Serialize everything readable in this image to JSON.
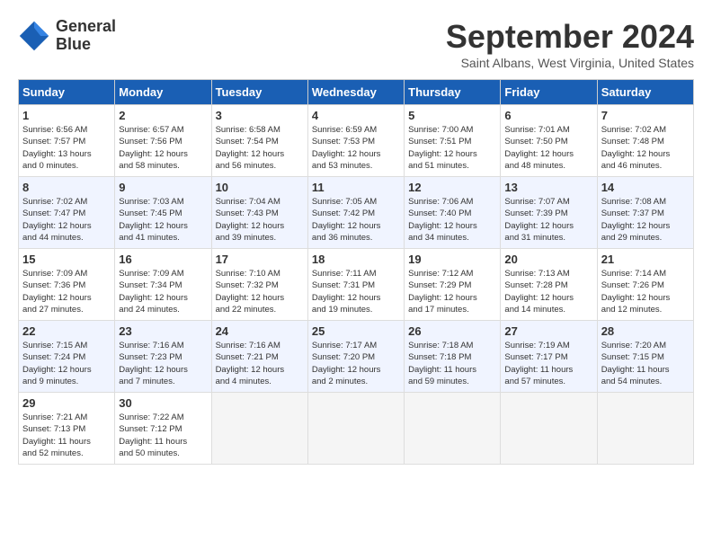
{
  "header": {
    "logo_line1": "General",
    "logo_line2": "Blue",
    "month": "September 2024",
    "location": "Saint Albans, West Virginia, United States"
  },
  "weekdays": [
    "Sunday",
    "Monday",
    "Tuesday",
    "Wednesday",
    "Thursday",
    "Friday",
    "Saturday"
  ],
  "weeks": [
    [
      {
        "day": "1",
        "info": "Sunrise: 6:56 AM\nSunset: 7:57 PM\nDaylight: 13 hours\nand 0 minutes."
      },
      {
        "day": "2",
        "info": "Sunrise: 6:57 AM\nSunset: 7:56 PM\nDaylight: 12 hours\nand 58 minutes."
      },
      {
        "day": "3",
        "info": "Sunrise: 6:58 AM\nSunset: 7:54 PM\nDaylight: 12 hours\nand 56 minutes."
      },
      {
        "day": "4",
        "info": "Sunrise: 6:59 AM\nSunset: 7:53 PM\nDaylight: 12 hours\nand 53 minutes."
      },
      {
        "day": "5",
        "info": "Sunrise: 7:00 AM\nSunset: 7:51 PM\nDaylight: 12 hours\nand 51 minutes."
      },
      {
        "day": "6",
        "info": "Sunrise: 7:01 AM\nSunset: 7:50 PM\nDaylight: 12 hours\nand 48 minutes."
      },
      {
        "day": "7",
        "info": "Sunrise: 7:02 AM\nSunset: 7:48 PM\nDaylight: 12 hours\nand 46 minutes."
      }
    ],
    [
      {
        "day": "8",
        "info": "Sunrise: 7:02 AM\nSunset: 7:47 PM\nDaylight: 12 hours\nand 44 minutes."
      },
      {
        "day": "9",
        "info": "Sunrise: 7:03 AM\nSunset: 7:45 PM\nDaylight: 12 hours\nand 41 minutes."
      },
      {
        "day": "10",
        "info": "Sunrise: 7:04 AM\nSunset: 7:43 PM\nDaylight: 12 hours\nand 39 minutes."
      },
      {
        "day": "11",
        "info": "Sunrise: 7:05 AM\nSunset: 7:42 PM\nDaylight: 12 hours\nand 36 minutes."
      },
      {
        "day": "12",
        "info": "Sunrise: 7:06 AM\nSunset: 7:40 PM\nDaylight: 12 hours\nand 34 minutes."
      },
      {
        "day": "13",
        "info": "Sunrise: 7:07 AM\nSunset: 7:39 PM\nDaylight: 12 hours\nand 31 minutes."
      },
      {
        "day": "14",
        "info": "Sunrise: 7:08 AM\nSunset: 7:37 PM\nDaylight: 12 hours\nand 29 minutes."
      }
    ],
    [
      {
        "day": "15",
        "info": "Sunrise: 7:09 AM\nSunset: 7:36 PM\nDaylight: 12 hours\nand 27 minutes."
      },
      {
        "day": "16",
        "info": "Sunrise: 7:09 AM\nSunset: 7:34 PM\nDaylight: 12 hours\nand 24 minutes."
      },
      {
        "day": "17",
        "info": "Sunrise: 7:10 AM\nSunset: 7:32 PM\nDaylight: 12 hours\nand 22 minutes."
      },
      {
        "day": "18",
        "info": "Sunrise: 7:11 AM\nSunset: 7:31 PM\nDaylight: 12 hours\nand 19 minutes."
      },
      {
        "day": "19",
        "info": "Sunrise: 7:12 AM\nSunset: 7:29 PM\nDaylight: 12 hours\nand 17 minutes."
      },
      {
        "day": "20",
        "info": "Sunrise: 7:13 AM\nSunset: 7:28 PM\nDaylight: 12 hours\nand 14 minutes."
      },
      {
        "day": "21",
        "info": "Sunrise: 7:14 AM\nSunset: 7:26 PM\nDaylight: 12 hours\nand 12 minutes."
      }
    ],
    [
      {
        "day": "22",
        "info": "Sunrise: 7:15 AM\nSunset: 7:24 PM\nDaylight: 12 hours\nand 9 minutes."
      },
      {
        "day": "23",
        "info": "Sunrise: 7:16 AM\nSunset: 7:23 PM\nDaylight: 12 hours\nand 7 minutes."
      },
      {
        "day": "24",
        "info": "Sunrise: 7:16 AM\nSunset: 7:21 PM\nDaylight: 12 hours\nand 4 minutes."
      },
      {
        "day": "25",
        "info": "Sunrise: 7:17 AM\nSunset: 7:20 PM\nDaylight: 12 hours\nand 2 minutes."
      },
      {
        "day": "26",
        "info": "Sunrise: 7:18 AM\nSunset: 7:18 PM\nDaylight: 11 hours\nand 59 minutes."
      },
      {
        "day": "27",
        "info": "Sunrise: 7:19 AM\nSunset: 7:17 PM\nDaylight: 11 hours\nand 57 minutes."
      },
      {
        "day": "28",
        "info": "Sunrise: 7:20 AM\nSunset: 7:15 PM\nDaylight: 11 hours\nand 54 minutes."
      }
    ],
    [
      {
        "day": "29",
        "info": "Sunrise: 7:21 AM\nSunset: 7:13 PM\nDaylight: 11 hours\nand 52 minutes."
      },
      {
        "day": "30",
        "info": "Sunrise: 7:22 AM\nSunset: 7:12 PM\nDaylight: 11 hours\nand 50 minutes."
      },
      {
        "day": "",
        "info": ""
      },
      {
        "day": "",
        "info": ""
      },
      {
        "day": "",
        "info": ""
      },
      {
        "day": "",
        "info": ""
      },
      {
        "day": "",
        "info": ""
      }
    ]
  ]
}
